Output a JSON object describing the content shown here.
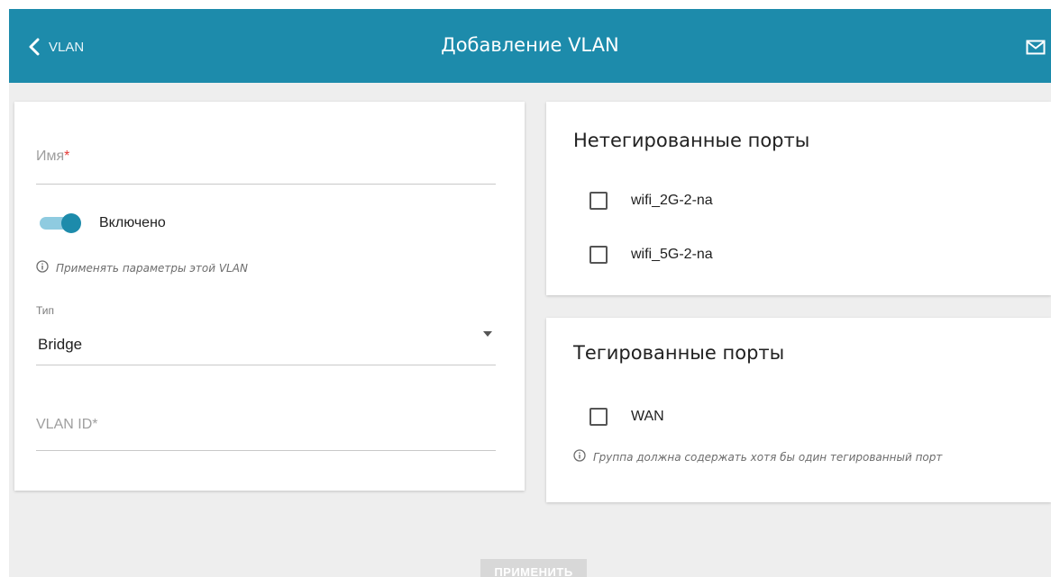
{
  "header": {
    "back_label": "VLAN",
    "title": "Добавление VLAN",
    "icons": {
      "back": "chevron-left-icon",
      "mail": "mail-icon"
    },
    "color": "#1d8bab"
  },
  "form": {
    "name_placeholder": "Имя",
    "required_mark": "*",
    "enabled_label": "Включено",
    "enabled": true,
    "enabled_hint": "Применять параметры этой VLAN",
    "type_label": "Тип",
    "type_value": "Bridge",
    "vlan_id_placeholder": "VLAN ID*"
  },
  "untagged": {
    "title": "Нетегированные порты",
    "ports": [
      {
        "label": "wifi_2G-2-na",
        "checked": false
      },
      {
        "label": "wifi_5G-2-na",
        "checked": false
      }
    ]
  },
  "tagged": {
    "title": "Тегированные порты",
    "ports": [
      {
        "label": "WAN",
        "checked": false
      }
    ],
    "hint": "Группа должна содержать хотя бы один тегированный порт"
  },
  "apply_label": "ПРИМЕНИТЬ"
}
